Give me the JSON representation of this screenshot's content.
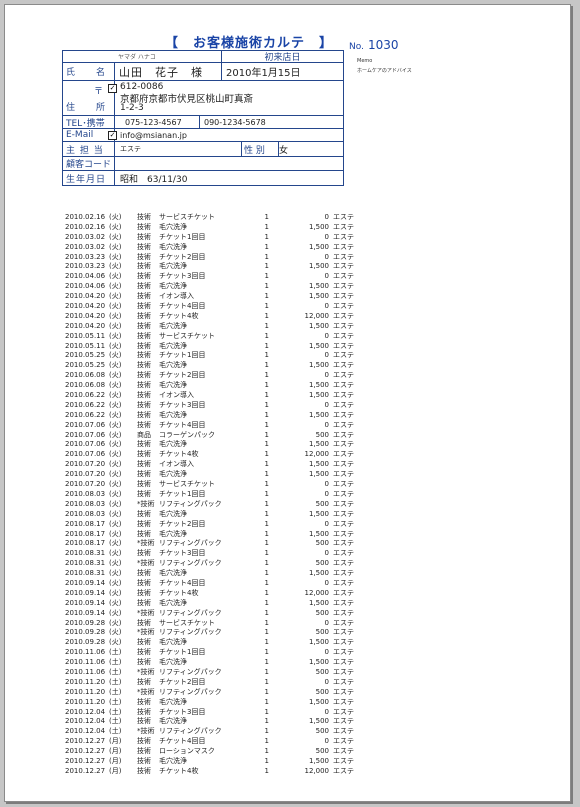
{
  "title": "【　お客様施術カルテ　】",
  "no_label": "No.",
  "no_value": "1030",
  "memo_label": "Memo",
  "memo_text": "ホームケアのアドバイス",
  "card": {
    "furigana": "ヤマダ ハナコ",
    "first_visit_label": "初来店日",
    "name_label": "氏　　名",
    "name": "山田　花子　様",
    "first_visit_date": "2010年1月15日",
    "address_label": "住　　所",
    "postal_mark": "〒",
    "postal": "612-0086",
    "address1": "京都府京都市伏見区桃山町真斎",
    "address2": "1-2-3",
    "tel_label": "TEL･携帯",
    "tel": "075-123-4567",
    "mobile": "090-1234-5678",
    "email_label": "E-Mail",
    "email": "info@msianan.jp",
    "check": "✓",
    "staff_label": "主 担 当",
    "staff": "エステ",
    "gender_label": "性 別",
    "gender": "女",
    "customer_code_label": "顧客コード",
    "customer_code": "",
    "birthday_label": "生年月日",
    "birthday": "昭和　63/11/30"
  },
  "records": [
    {
      "date": "2010.02.16",
      "day": "(火)",
      "cat": "技術",
      "item": "サービスチケット",
      "qty": "1",
      "price": "0",
      "staff": "エステ"
    },
    {
      "date": "2010.02.16",
      "day": "(火)",
      "cat": "技術",
      "item": "毛穴洗浄",
      "qty": "1",
      "price": "1,500",
      "staff": "エステ"
    },
    {
      "date": "2010.03.02",
      "day": "(火)",
      "cat": "技術",
      "item": "チケット1回目",
      "qty": "1",
      "price": "0",
      "staff": "エステ"
    },
    {
      "date": "2010.03.02",
      "day": "(火)",
      "cat": "技術",
      "item": "毛穴洗浄",
      "qty": "1",
      "price": "1,500",
      "staff": "エステ"
    },
    {
      "date": "2010.03.23",
      "day": "(火)",
      "cat": "技術",
      "item": "チケット2回目",
      "qty": "1",
      "price": "0",
      "staff": "エステ"
    },
    {
      "date": "2010.03.23",
      "day": "(火)",
      "cat": "技術",
      "item": "毛穴洗浄",
      "qty": "1",
      "price": "1,500",
      "staff": "エステ"
    },
    {
      "date": "2010.04.06",
      "day": "(火)",
      "cat": "技術",
      "item": "チケット3回目",
      "qty": "1",
      "price": "0",
      "staff": "エステ"
    },
    {
      "date": "2010.04.06",
      "day": "(火)",
      "cat": "技術",
      "item": "毛穴洗浄",
      "qty": "1",
      "price": "1,500",
      "staff": "エステ"
    },
    {
      "date": "2010.04.20",
      "day": "(火)",
      "cat": "技術",
      "item": "イオン導入",
      "qty": "1",
      "price": "1,500",
      "staff": "エステ"
    },
    {
      "date": "2010.04.20",
      "day": "(火)",
      "cat": "技術",
      "item": "チケット4回目",
      "qty": "1",
      "price": "0",
      "staff": "エステ"
    },
    {
      "date": "2010.04.20",
      "day": "(火)",
      "cat": "技術",
      "item": "チケット4枚",
      "qty": "1",
      "price": "12,000",
      "staff": "エステ"
    },
    {
      "date": "2010.04.20",
      "day": "(火)",
      "cat": "技術",
      "item": "毛穴洗浄",
      "qty": "1",
      "price": "1,500",
      "staff": "エステ"
    },
    {
      "date": "2010.05.11",
      "day": "(火)",
      "cat": "技術",
      "item": "サービスチケット",
      "qty": "1",
      "price": "0",
      "staff": "エステ"
    },
    {
      "date": "2010.05.11",
      "day": "(火)",
      "cat": "技術",
      "item": "毛穴洗浄",
      "qty": "1",
      "price": "1,500",
      "staff": "エステ"
    },
    {
      "date": "2010.05.25",
      "day": "(火)",
      "cat": "技術",
      "item": "チケット1回目",
      "qty": "1",
      "price": "0",
      "staff": "エステ"
    },
    {
      "date": "2010.05.25",
      "day": "(火)",
      "cat": "技術",
      "item": "毛穴洗浄",
      "qty": "1",
      "price": "1,500",
      "staff": "エステ"
    },
    {
      "date": "2010.06.08",
      "day": "(火)",
      "cat": "技術",
      "item": "チケット2回目",
      "qty": "1",
      "price": "0",
      "staff": "エステ"
    },
    {
      "date": "2010.06.08",
      "day": "(火)",
      "cat": "技術",
      "item": "毛穴洗浄",
      "qty": "1",
      "price": "1,500",
      "staff": "エステ"
    },
    {
      "date": "2010.06.22",
      "day": "(火)",
      "cat": "技術",
      "item": "イオン導入",
      "qty": "1",
      "price": "1,500",
      "staff": "エステ"
    },
    {
      "date": "2010.06.22",
      "day": "(火)",
      "cat": "技術",
      "item": "チケット3回目",
      "qty": "1",
      "price": "0",
      "staff": "エステ"
    },
    {
      "date": "2010.06.22",
      "day": "(火)",
      "cat": "技術",
      "item": "毛穴洗浄",
      "qty": "1",
      "price": "1,500",
      "staff": "エステ"
    },
    {
      "date": "2010.07.06",
      "day": "(火)",
      "cat": "技術",
      "item": "チケット4回目",
      "qty": "1",
      "price": "0",
      "staff": "エステ"
    },
    {
      "date": "2010.07.06",
      "day": "(火)",
      "cat": "商品",
      "item": "コラーゲンパック",
      "qty": "1",
      "price": "500",
      "staff": "エステ"
    },
    {
      "date": "2010.07.06",
      "day": "(火)",
      "cat": "技術",
      "item": "毛穴洗浄",
      "qty": "1",
      "price": "1,500",
      "staff": "エステ"
    },
    {
      "date": "2010.07.06",
      "day": "(火)",
      "cat": "技術",
      "item": "チケット4枚",
      "qty": "1",
      "price": "12,000",
      "staff": "エステ"
    },
    {
      "date": "2010.07.20",
      "day": "(火)",
      "cat": "技術",
      "item": "イオン導入",
      "qty": "1",
      "price": "1,500",
      "staff": "エステ"
    },
    {
      "date": "2010.07.20",
      "day": "(火)",
      "cat": "技術",
      "item": "毛穴洗浄",
      "qty": "1",
      "price": "1,500",
      "staff": "エステ"
    },
    {
      "date": "2010.07.20",
      "day": "(火)",
      "cat": "技術",
      "item": "サービスチケット",
      "qty": "1",
      "price": "0",
      "staff": "エステ"
    },
    {
      "date": "2010.08.03",
      "day": "(火)",
      "cat": "技術",
      "item": "チケット1回目",
      "qty": "1",
      "price": "0",
      "staff": "エステ"
    },
    {
      "date": "2010.08.03",
      "day": "(火)",
      "cat": "*技術",
      "item": "リフティングパック",
      "qty": "1",
      "price": "500",
      "staff": "エステ"
    },
    {
      "date": "2010.08.03",
      "day": "(火)",
      "cat": "技術",
      "item": "毛穴洗浄",
      "qty": "1",
      "price": "1,500",
      "staff": "エステ"
    },
    {
      "date": "2010.08.17",
      "day": "(火)",
      "cat": "技術",
      "item": "チケット2回目",
      "qty": "1",
      "price": "0",
      "staff": "エステ"
    },
    {
      "date": "2010.08.17",
      "day": "(火)",
      "cat": "技術",
      "item": "毛穴洗浄",
      "qty": "1",
      "price": "1,500",
      "staff": "エステ"
    },
    {
      "date": "2010.08.17",
      "day": "(火)",
      "cat": "*技術",
      "item": "リフティングパック",
      "qty": "1",
      "price": "500",
      "staff": "エステ"
    },
    {
      "date": "2010.08.31",
      "day": "(火)",
      "cat": "技術",
      "item": "チケット3回目",
      "qty": "1",
      "price": "0",
      "staff": "エステ"
    },
    {
      "date": "2010.08.31",
      "day": "(火)",
      "cat": "*技術",
      "item": "リフティングパック",
      "qty": "1",
      "price": "500",
      "staff": "エステ"
    },
    {
      "date": "2010.08.31",
      "day": "(火)",
      "cat": "技術",
      "item": "毛穴洗浄",
      "qty": "1",
      "price": "1,500",
      "staff": "エステ"
    },
    {
      "date": "2010.09.14",
      "day": "(火)",
      "cat": "技術",
      "item": "チケット4回目",
      "qty": "1",
      "price": "0",
      "staff": "エステ"
    },
    {
      "date": "2010.09.14",
      "day": "(火)",
      "cat": "技術",
      "item": "チケット4枚",
      "qty": "1",
      "price": "12,000",
      "staff": "エステ"
    },
    {
      "date": "2010.09.14",
      "day": "(火)",
      "cat": "技術",
      "item": "毛穴洗浄",
      "qty": "1",
      "price": "1,500",
      "staff": "エステ"
    },
    {
      "date": "2010.09.14",
      "day": "(火)",
      "cat": "*技術",
      "item": "リフティングパック",
      "qty": "1",
      "price": "500",
      "staff": "エステ"
    },
    {
      "date": "2010.09.28",
      "day": "(火)",
      "cat": "技術",
      "item": "サービスチケット",
      "qty": "1",
      "price": "0",
      "staff": "エステ"
    },
    {
      "date": "2010.09.28",
      "day": "(火)",
      "cat": "*技術",
      "item": "リフティングパック",
      "qty": "1",
      "price": "500",
      "staff": "エステ"
    },
    {
      "date": "2010.09.28",
      "day": "(火)",
      "cat": "技術",
      "item": "毛穴洗浄",
      "qty": "1",
      "price": "1,500",
      "staff": "エステ"
    },
    {
      "date": "2010.11.06",
      "day": "(土)",
      "cat": "技術",
      "item": "チケット1回目",
      "qty": "1",
      "price": "0",
      "staff": "エステ"
    },
    {
      "date": "2010.11.06",
      "day": "(土)",
      "cat": "技術",
      "item": "毛穴洗浄",
      "qty": "1",
      "price": "1,500",
      "staff": "エステ"
    },
    {
      "date": "2010.11.06",
      "day": "(土)",
      "cat": "*技術",
      "item": "リフティングパック",
      "qty": "1",
      "price": "500",
      "staff": "エステ"
    },
    {
      "date": "2010.11.20",
      "day": "(土)",
      "cat": "技術",
      "item": "チケット2回目",
      "qty": "1",
      "price": "0",
      "staff": "エステ"
    },
    {
      "date": "2010.11.20",
      "day": "(土)",
      "cat": "*技術",
      "item": "リフティングパック",
      "qty": "1",
      "price": "500",
      "staff": "エステ"
    },
    {
      "date": "2010.11.20",
      "day": "(土)",
      "cat": "技術",
      "item": "毛穴洗浄",
      "qty": "1",
      "price": "1,500",
      "staff": "エステ"
    },
    {
      "date": "2010.12.04",
      "day": "(土)",
      "cat": "技術",
      "item": "チケット3回目",
      "qty": "1",
      "price": "0",
      "staff": "エステ"
    },
    {
      "date": "2010.12.04",
      "day": "(土)",
      "cat": "技術",
      "item": "毛穴洗浄",
      "qty": "1",
      "price": "1,500",
      "staff": "エステ"
    },
    {
      "date": "2010.12.04",
      "day": "(土)",
      "cat": "*技術",
      "item": "リフティングパック",
      "qty": "1",
      "price": "500",
      "staff": "エステ"
    },
    {
      "date": "2010.12.27",
      "day": "(月)",
      "cat": "技術",
      "item": "チケット4回目",
      "qty": "1",
      "price": "0",
      "staff": "エステ"
    },
    {
      "date": "2010.12.27",
      "day": "(月)",
      "cat": "技術",
      "item": "ローションマスク",
      "qty": "1",
      "price": "500",
      "staff": "エステ"
    },
    {
      "date": "2010.12.27",
      "day": "(月)",
      "cat": "技術",
      "item": "毛穴洗浄",
      "qty": "1",
      "price": "1,500",
      "staff": "エステ"
    },
    {
      "date": "2010.12.27",
      "day": "(月)",
      "cat": "技術",
      "item": "チケット4枚",
      "qty": "1",
      "price": "12,000",
      "staff": "エステ"
    }
  ]
}
